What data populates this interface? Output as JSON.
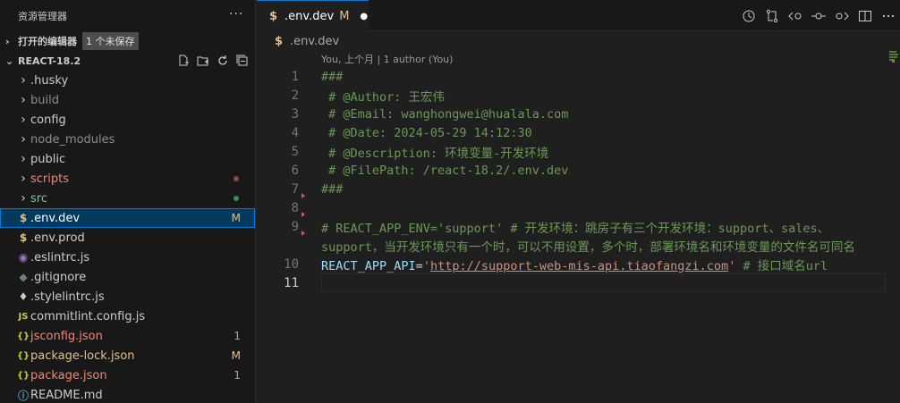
{
  "sidebar": {
    "title": "资源管理器",
    "more_label": "···",
    "open_editors": {
      "label": "打开的编辑器",
      "badge": "1 个未保存"
    },
    "project": {
      "label": "REACT-18.2"
    },
    "items": [
      {
        "name": ".husky",
        "kind": "folder",
        "color": "default",
        "decoration": ""
      },
      {
        "name": "build",
        "kind": "folder",
        "color": "dim",
        "decoration": ""
      },
      {
        "name": "config",
        "kind": "folder",
        "color": "default",
        "decoration": ""
      },
      {
        "name": "node_modules",
        "kind": "folder",
        "color": "dim",
        "decoration": ""
      },
      {
        "name": "public",
        "kind": "folder",
        "color": "default",
        "decoration": ""
      },
      {
        "name": "scripts",
        "kind": "folder",
        "color": "red",
        "decoration": "dot-red"
      },
      {
        "name": "src",
        "kind": "folder",
        "color": "green",
        "decoration": "dot-green"
      },
      {
        "name": ".env.dev",
        "kind": "file",
        "icon": "$",
        "color": "default",
        "decoration": "M",
        "active": true
      },
      {
        "name": ".env.prod",
        "kind": "file",
        "icon": "$",
        "color": "default",
        "decoration": ""
      },
      {
        "name": ".eslintrc.js",
        "kind": "file",
        "icon": "◉",
        "color": "default",
        "decoration": ""
      },
      {
        "name": ".gitignore",
        "kind": "file",
        "icon": "◆",
        "color": "default",
        "decoration": ""
      },
      {
        "name": ".stylelintrc.js",
        "kind": "file",
        "icon": "♦",
        "color": "default",
        "decoration": ""
      },
      {
        "name": "commitlint.config.js",
        "kind": "file",
        "icon": "JS",
        "color": "default",
        "decoration": ""
      },
      {
        "name": "jsconfig.json",
        "kind": "file",
        "icon": "{}",
        "color": "red",
        "decoration": "1"
      },
      {
        "name": "package-lock.json",
        "kind": "file",
        "icon": "{}",
        "color": "mod",
        "decoration": "M"
      },
      {
        "name": "package.json",
        "kind": "file",
        "icon": "{}",
        "color": "red",
        "decoration": "1"
      },
      {
        "name": "README.md",
        "kind": "file",
        "icon": "ⓘ",
        "color": "default",
        "decoration": ""
      }
    ]
  },
  "editor": {
    "tab": {
      "icon": "$",
      "name": ".env.dev",
      "status": "M",
      "dirty": "●"
    },
    "breadcrumb": {
      "icon": "$",
      "name": ".env.dev"
    },
    "codelens": "You, 上个月 | 1 author (You)",
    "lines": [
      {
        "num": "1",
        "text": "###",
        "type": "comment"
      },
      {
        "num": "2",
        "text": " # @Author: 王宏伟",
        "type": "comment"
      },
      {
        "num": "3",
        "text": " # @Email: wanghongwei@hualala.com",
        "type": "comment"
      },
      {
        "num": "4",
        "text": " # @Date: 2024-05-29 14:12:30",
        "type": "comment"
      },
      {
        "num": "5",
        "text": " # @Description: 环境变量-开发环境",
        "type": "comment"
      },
      {
        "num": "6",
        "text": " # @FilePath: /react-18.2/.env.dev",
        "type": "comment"
      },
      {
        "num": "7",
        "text": "###",
        "type": "comment",
        "mark": true
      },
      {
        "num": "8",
        "text": "",
        "type": "comment",
        "mark": true
      },
      {
        "num": "9",
        "text": "# REACT_APP_ENV='support' # 开发环境：跳房子有三个开发环境：support、sales、",
        "type": "comment",
        "mark": true
      },
      {
        "num": "",
        "text": "support，当开发环境只有一个时，可以不用设置，多个时，部署环境名和环境变量的文件名可同名",
        "type": "comment"
      },
      {
        "num": "10",
        "type": "assign",
        "key": "REACT_APP_API",
        "eq": "=",
        "q1": "'",
        "value": "http://support-web-mis-api.tiaofangzi.com",
        "q2": "'",
        "comment": " # 接口域名url"
      },
      {
        "num": "11",
        "text": "",
        "type": "comment",
        "current": true
      }
    ]
  }
}
